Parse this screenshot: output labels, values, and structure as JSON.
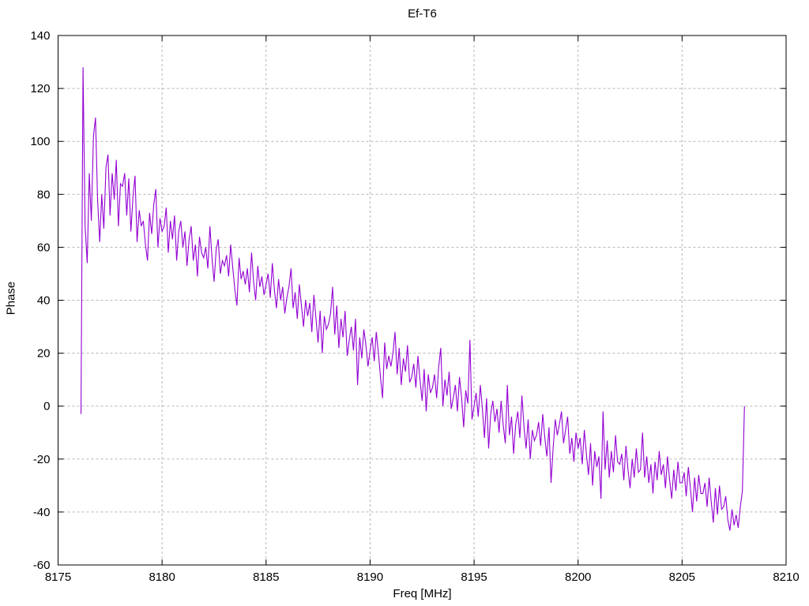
{
  "window": {
    "background": "#ffffff"
  },
  "chart_data": {
    "type": "line",
    "title": "Ef-T6",
    "xlabel": "Freq [MHz]",
    "ylabel": "Phase",
    "xlim": [
      8175,
      8210
    ],
    "ylim": [
      -60,
      140
    ],
    "x_ticks": [
      8175,
      8180,
      8185,
      8190,
      8195,
      8200,
      8205,
      8210
    ],
    "y_ticks": [
      -60,
      -40,
      -20,
      0,
      20,
      40,
      60,
      80,
      100,
      120,
      140
    ],
    "grid": true,
    "legend": false,
    "line_color": "#9400d3",
    "grid_color": "#b5b5b5",
    "axis_color": "#000000",
    "series": [
      {
        "name": "Phase",
        "x_start": 8176.1,
        "x_step": 0.1,
        "values": [
          -3,
          128,
          68,
          54,
          88,
          70,
          102,
          109,
          78,
          62,
          80,
          67,
          90,
          95,
          72,
          88,
          78,
          93,
          68,
          84,
          83,
          88,
          72,
          86,
          66,
          79,
          87,
          62,
          74,
          68,
          70,
          61,
          55,
          73,
          65,
          76,
          82,
          60,
          71,
          66,
          68,
          75,
          58,
          70,
          63,
          72,
          55,
          66,
          70,
          60,
          66,
          53,
          63,
          68,
          55,
          61,
          49,
          64,
          58,
          56,
          60,
          52,
          68,
          56,
          47,
          59,
          63,
          50,
          55,
          53,
          57,
          49,
          61,
          52,
          44,
          38,
          56,
          48,
          51,
          46,
          52,
          43,
          58,
          47,
          40,
          53,
          45,
          49,
          42,
          46,
          50,
          41,
          54,
          44,
          37,
          48,
          40,
          45,
          35,
          41,
          45,
          52,
          37,
          43,
          33,
          46,
          38,
          30,
          40,
          34,
          39,
          28,
          42,
          33,
          24,
          36,
          20,
          34,
          29,
          31,
          35,
          45,
          27,
          38,
          22,
          33,
          26,
          36,
          19,
          25,
          30,
          21,
          33,
          8,
          26,
          18,
          29,
          23,
          15,
          21,
          26,
          17,
          28,
          20,
          11,
          3,
          24,
          14,
          19,
          15,
          20,
          28,
          12,
          22,
          8,
          18,
          13,
          23,
          9,
          11,
          16,
          7,
          19,
          10,
          2,
          14,
          -2,
          12,
          5,
          7,
          12,
          3,
          15,
          22,
          0,
          10,
          4,
          13,
          -1,
          3,
          8,
          -2,
          11,
          3,
          -8,
          6,
          1,
          25,
          -5,
          0,
          5,
          -4,
          8,
          -1,
          -12,
          3,
          -16,
          -3,
          2,
          -6,
          -1,
          -10,
          2,
          -7,
          -14,
          8,
          -11,
          -4,
          -18,
          -7,
          -2,
          -12,
          4,
          -8,
          -16,
          -5,
          -20,
          -9,
          -13,
          -11,
          -6,
          -15,
          -3,
          -12,
          -19,
          -8,
          -29,
          -16,
          -5,
          -11,
          -7,
          -2,
          -14,
          -9,
          -4,
          -18,
          -12,
          -21,
          -10,
          -16,
          -12,
          -22,
          -9,
          -18,
          -26,
          -14,
          -30,
          -17,
          -23,
          -19,
          -35,
          -2,
          -24,
          -13,
          -27,
          -17,
          -25,
          -11,
          -21,
          -22,
          -18,
          -28,
          -15,
          -24,
          -31,
          -20,
          -27,
          -16,
          -25,
          -24,
          -10,
          -27,
          -19,
          -29,
          -22,
          -33,
          -21,
          -28,
          -17,
          -26,
          -22,
          -31,
          -19,
          -28,
          -35,
          -24,
          -32,
          -21,
          -29,
          -29,
          -25,
          -34,
          -23,
          -31,
          -40,
          -27,
          -36,
          -26,
          -33,
          -33,
          -29,
          -38,
          -27,
          -36,
          -44,
          -31,
          -41,
          -30,
          -39,
          -38,
          -34,
          -43,
          -47,
          -39,
          -45,
          -41,
          -46,
          -38,
          -32,
          0
        ]
      }
    ]
  }
}
